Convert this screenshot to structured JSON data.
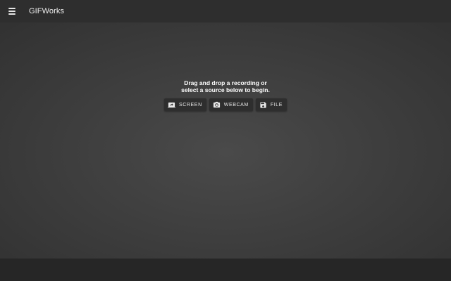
{
  "app_bar": {
    "title": "GIFWorks",
    "menu_icon": "menu-icon"
  },
  "main": {
    "prompt_line1": "Drag and drop a recording or",
    "prompt_line2": "select a source below to begin.",
    "sources": [
      {
        "label": "SCREEN",
        "icon": "screen-share-icon"
      },
      {
        "label": "WEBCAM",
        "icon": "camera-icon"
      },
      {
        "label": "FILE",
        "icon": "save-icon"
      }
    ]
  },
  "colors": {
    "app_bar": "#2e2e2e",
    "background_center": "#4a4a4a",
    "background_edge": "#323232",
    "bottom_bar": "#262626",
    "text": "#ffffff"
  }
}
